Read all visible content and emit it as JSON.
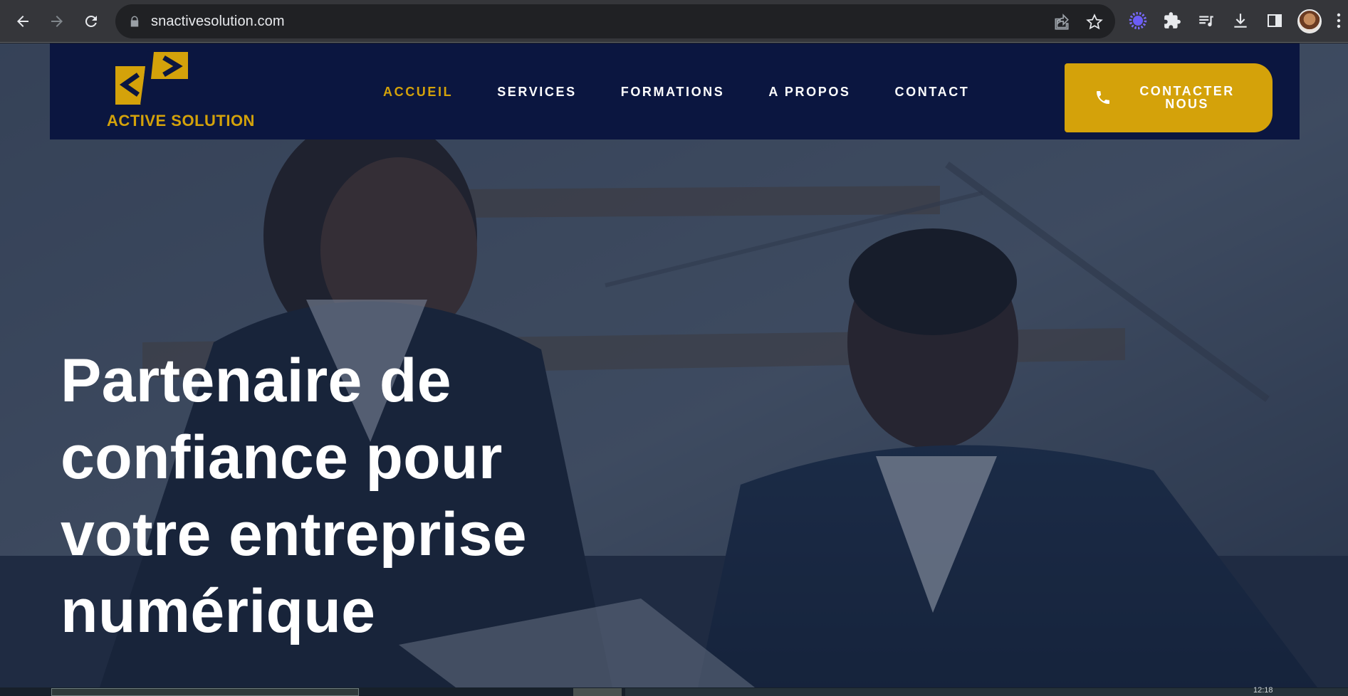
{
  "browser": {
    "url": "snactivesolution.com",
    "back_icon": "arrow-left-icon",
    "forward_icon": "arrow-right-icon",
    "reload_icon": "reload-icon",
    "lock_icon": "lock-icon"
  },
  "header": {
    "logo_text": "ACTIVE SOLUTION",
    "nav": [
      {
        "label": "ACCUEIL",
        "active": true
      },
      {
        "label": "SERVICES",
        "active": false
      },
      {
        "label": "FORMATIONS",
        "active": false
      },
      {
        "label": "A PROPOS",
        "active": false
      },
      {
        "label": "CONTACT",
        "active": false
      }
    ],
    "cta_line1": "CONTACTER",
    "cta_line2": "NOUS"
  },
  "hero": {
    "title_line1": "Partenaire de",
    "title_line2": "confiance pour",
    "title_line3": "votre entreprise",
    "title_line4": "numérique"
  },
  "footer_strip": {
    "time": "12:18"
  },
  "colors": {
    "brand_navy": "#0b1640",
    "brand_gold": "#d4a20a",
    "chrome_bg": "#35363a"
  }
}
